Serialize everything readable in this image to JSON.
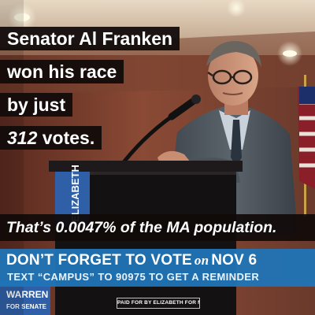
{
  "headline": {
    "line1": "Senator Al Franken",
    "line2": "won his race",
    "line3": "by just",
    "line4_number": "312",
    "line4_rest": " votes."
  },
  "stat": "That’s 0.0047% of the MA population.",
  "banner": {
    "line1_pre": "DON’T FORGET TO VOTE",
    "line1_on": "on",
    "line1_date": "NOV 6",
    "line2": "TEXT “CAMPUS” TO 90975 TO GET A REMINDER"
  },
  "disclaimer": "PAID FOR BY ELIZABETH FOR MA",
  "podium_sign": {
    "brand": "ELIZABETH",
    "bottom_brand": "WARREN",
    "bottom_sub": "FOR SENATE"
  },
  "colors": {
    "banner_blue": "#2075b8",
    "caption_bg": "#120c0b",
    "text": "#ffffff",
    "podium": "#141113",
    "sign_blue": "#2f5fa6"
  }
}
